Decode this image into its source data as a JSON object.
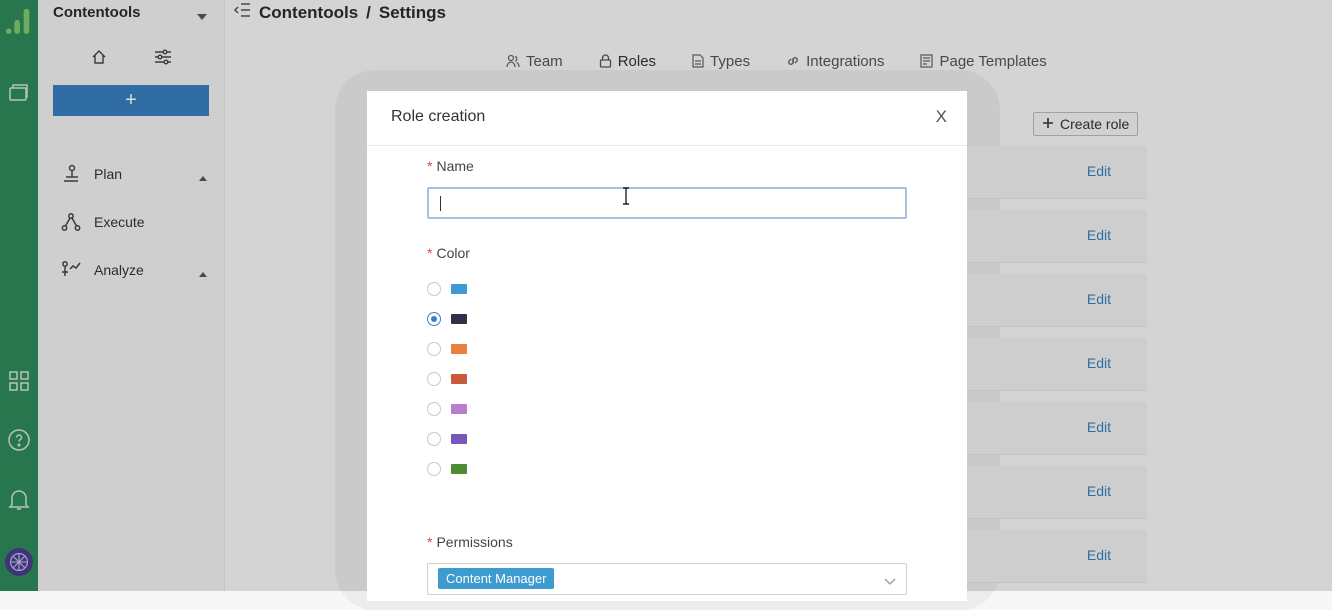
{
  "app": {
    "workspace": "Contentools"
  },
  "breadcrumb": {
    "root": "Contentools",
    "separator": "/",
    "current": "Settings"
  },
  "sidebar": {
    "add_label": "+",
    "items": [
      {
        "label": "Plan",
        "icon": "plan-icon"
      },
      {
        "label": "Execute",
        "icon": "execute-icon"
      },
      {
        "label": "Analyze",
        "icon": "analyze-icon"
      }
    ]
  },
  "tabs": [
    {
      "label": "Team",
      "icon": "team-icon"
    },
    {
      "label": "Roles",
      "icon": "lock-icon",
      "active": true
    },
    {
      "label": "Types",
      "icon": "document-icon"
    },
    {
      "label": "Integrations",
      "icon": "link-icon"
    },
    {
      "label": "Page Templates",
      "icon": "template-icon"
    }
  ],
  "roles_page": {
    "create_label": "Create role",
    "row_action": "Edit"
  },
  "modal": {
    "title": "Role creation",
    "close_label": "X",
    "name_label": "Name",
    "name_value": "",
    "color_label": "Color",
    "colors": [
      "#3b9bd4",
      "#2e3147",
      "#e8813e",
      "#c9593a",
      "#b77ed0",
      "#7558b8",
      "#4e8c34"
    ],
    "selected_color_index": 1,
    "required_mark": "*",
    "permissions_label": "Permissions",
    "permissions_selected": [
      "Content Manager"
    ]
  }
}
